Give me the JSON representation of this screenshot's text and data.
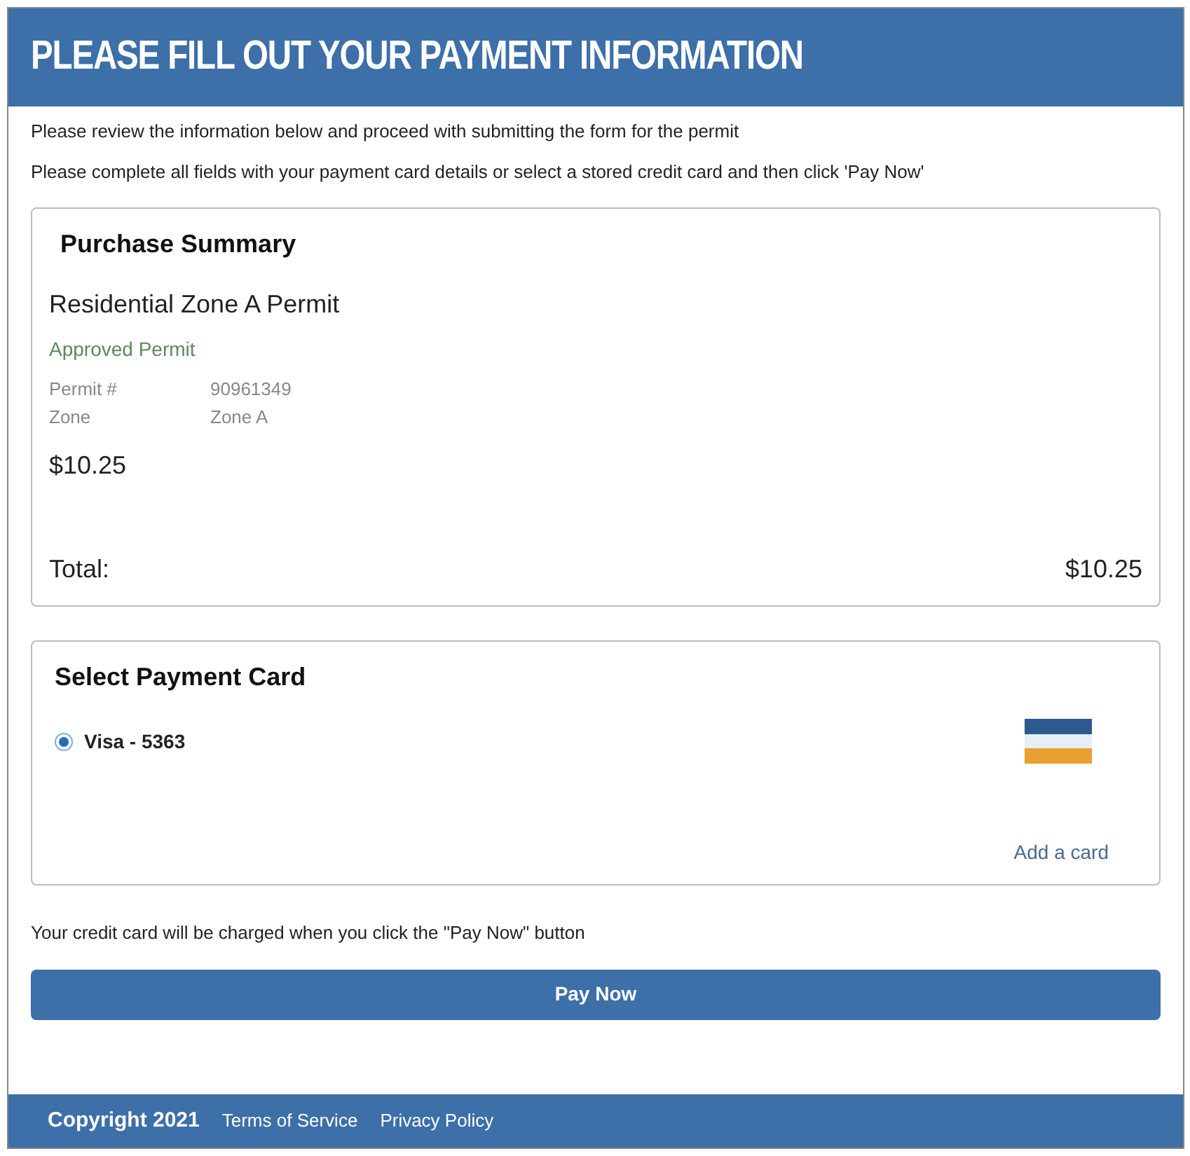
{
  "header": {
    "title": "PLEASE FILL OUT YOUR PAYMENT INFORMATION"
  },
  "intro": [
    "Please review the information below and proceed with submitting the form for the permit",
    "Please complete all fields with your payment card details or select a stored credit card and then click 'Pay Now'"
  ],
  "purchase_summary": {
    "title": "Purchase Summary",
    "item_name": "Residential Zone A Permit",
    "status": "Approved Permit",
    "details": [
      {
        "label": "Permit #",
        "value": "90961349"
      },
      {
        "label": "Zone",
        "value": "Zone A"
      }
    ],
    "price": "$10.25",
    "total_label": "Total:",
    "total": "$10.25"
  },
  "payment_card": {
    "title": "Select Payment Card",
    "cards": [
      {
        "label": "Visa - 5363",
        "selected": true
      }
    ],
    "add_link": "Add a card"
  },
  "notice": "Your credit card will be charged when you click the \"Pay Now\" button",
  "pay_button": "Pay Now",
  "footer": {
    "copyright": "Copyright 2021",
    "links": [
      "Terms of Service",
      "Privacy Policy"
    ]
  }
}
